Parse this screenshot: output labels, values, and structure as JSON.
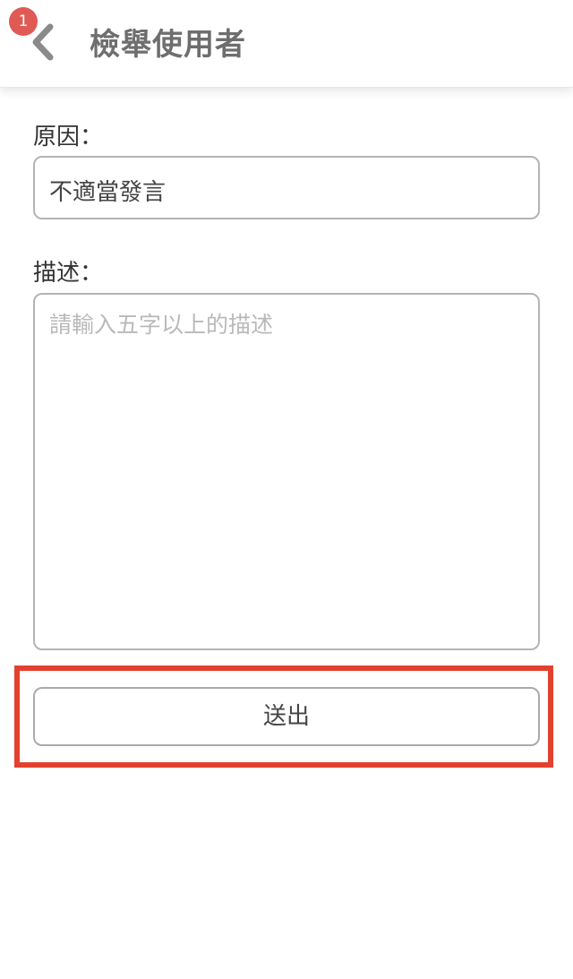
{
  "header": {
    "title": "檢舉使用者",
    "notification_count": "1",
    "back_icon": "chevron-left-icon"
  },
  "form": {
    "reason_label": "原因：",
    "reason_value": "不適當發言",
    "description_label": "描述：",
    "description_placeholder": "請輸入五字以上的描述",
    "description_value": "",
    "submit_label": "送出"
  },
  "colors": {
    "badge": "#e05a55",
    "highlight": "#e2412f",
    "title": "#6e6e6e",
    "border": "#b4b4b4"
  }
}
